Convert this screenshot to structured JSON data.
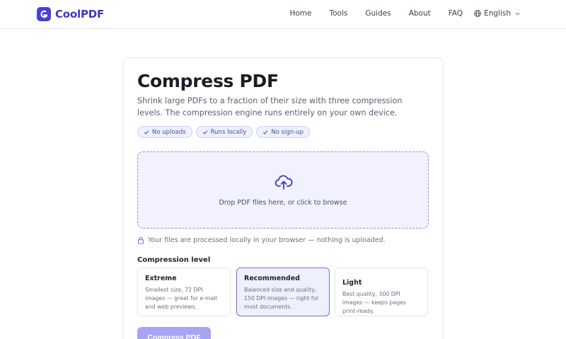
{
  "brand": {
    "name": "CoolPDF",
    "accent": "#4a3fd6"
  },
  "nav": {
    "items": [
      {
        "label": "Home"
      },
      {
        "label": "Tools"
      },
      {
        "label": "Guides"
      },
      {
        "label": "About"
      },
      {
        "label": "FAQ"
      }
    ],
    "language": "English"
  },
  "page": {
    "title": "Compress PDF",
    "subtitle": "Shrink large PDFs to a fraction of their size with three compression levels. The compression engine runs entirely on your own device.",
    "badges": [
      {
        "label": "No uploads"
      },
      {
        "label": "Runs locally"
      },
      {
        "label": "No sign-up"
      }
    ],
    "dropzone": {
      "text": "Drop PDF files here, or click to browse",
      "icon": "upload-cloud-icon"
    },
    "privacy_note": "Your files are processed locally in your browser — nothing is uploaded.",
    "compression": {
      "heading": "Compression level",
      "options": [
        {
          "title": "Extreme",
          "description": "Smallest size, 72 DPI images — great for e-mail and web previews.",
          "selected": false
        },
        {
          "title": "Recommended",
          "description": "Balanced size and quality, 150 DPI images — right for most documents.",
          "selected": true
        },
        {
          "title": "Light",
          "description": "Best quality, 300 DPI images — keeps pages print-ready.",
          "selected": false
        }
      ]
    },
    "action_button": "Compress PDF"
  }
}
